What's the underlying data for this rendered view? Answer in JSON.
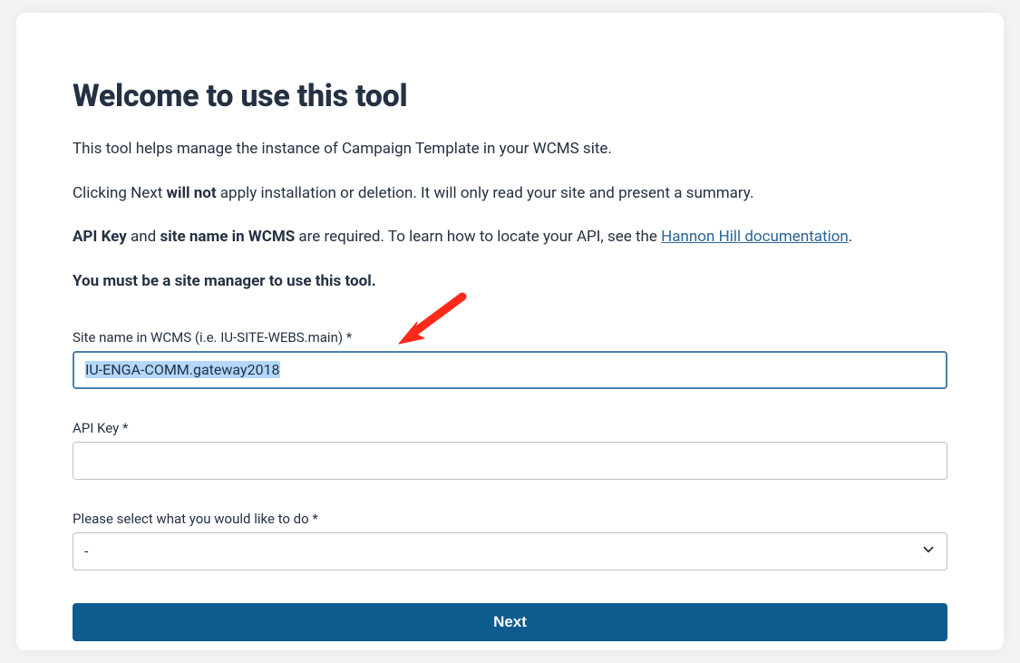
{
  "header": {
    "title": "Welcome to use this tool"
  },
  "intro": {
    "line1": "This tool helps manage the instance of Campaign Template in your WCMS site.",
    "line2_pre": "Clicking Next ",
    "line2_strong": "will not",
    "line2_post": " apply installation or deletion. It will only read your site and present a summary.",
    "line3_strong1": "API Key",
    "line3_mid1": " and ",
    "line3_strong2": "site name in WCMS",
    "line3_mid2": " are required. To learn how to locate your API, see the ",
    "line3_link": "Hannon Hill documentation",
    "line3_post": ".",
    "line4_strong": "You must be a site manager to use this tool."
  },
  "form": {
    "site_name": {
      "label": "Site name in WCMS (i.e. IU-SITE-WEBS.main) *",
      "value": "IU-ENGA-COMM.gateway2018"
    },
    "api_key": {
      "label": "API Key *",
      "value": ""
    },
    "action": {
      "label": "Please select what you would like to do *",
      "value": "-"
    },
    "submit_label": "Next"
  }
}
